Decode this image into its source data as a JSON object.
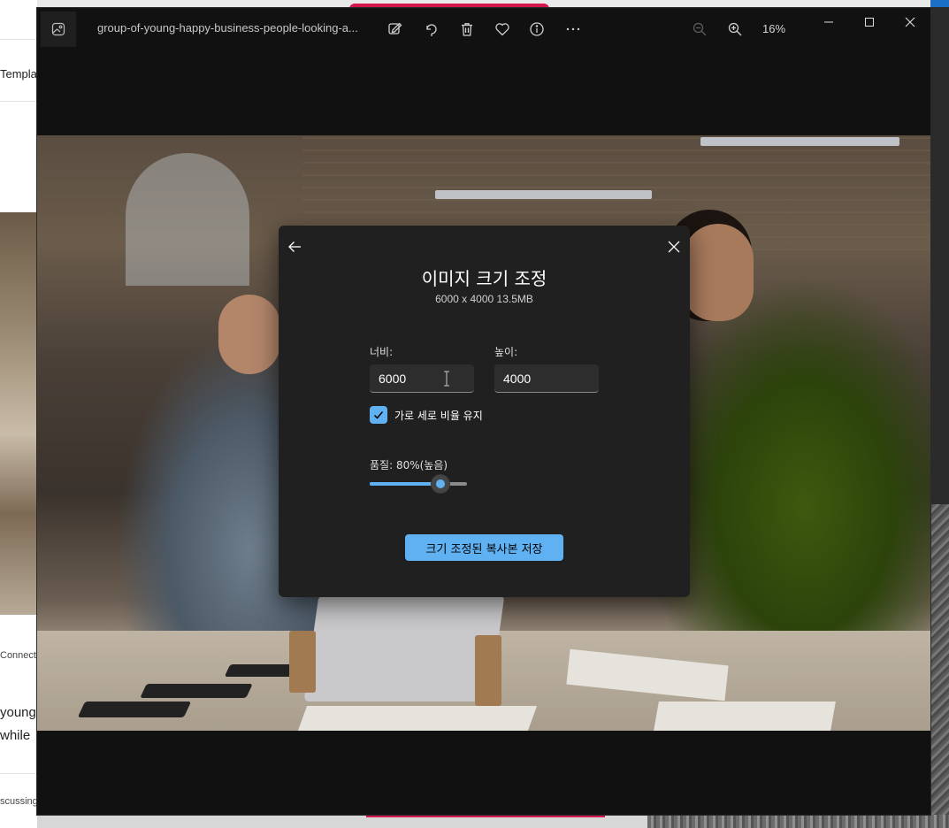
{
  "background_app": {
    "left_strip": {
      "templates_fragment": "Templa",
      "connect_fragment": "Connect",
      "young_fragment": "young",
      "while_fragment": "while",
      "discussing_fragment": "scussing"
    }
  },
  "viewer": {
    "filename": "group-of-young-happy-business-people-looking-a...",
    "zoom_level": "16%",
    "icons": {
      "app": "image-icon",
      "edit": "edit-image-icon",
      "rotate": "rotate-icon",
      "delete": "trash-icon",
      "favorite": "heart-icon",
      "info": "info-icon",
      "more": "more-icon",
      "zoom_out": "zoom-out-icon",
      "zoom_in": "zoom-in-icon",
      "minimize": "minimize-icon",
      "maximize": "maximize-icon",
      "close": "close-icon"
    }
  },
  "dialog": {
    "title": "이미지 크기 조정",
    "subtitle": "6000 x 4000   13.5MB",
    "width_label": "너비:",
    "width_value": "6000",
    "height_label": "높이:",
    "height_value": "4000",
    "keep_ratio_label": "가로 세로 비율 유지",
    "keep_ratio_checked": true,
    "quality_label": "품질: 80%(높음)",
    "quality_value": 80,
    "save_button_label": "크기 조정된 복사본 저장",
    "accent_color": "#60b1f2"
  }
}
